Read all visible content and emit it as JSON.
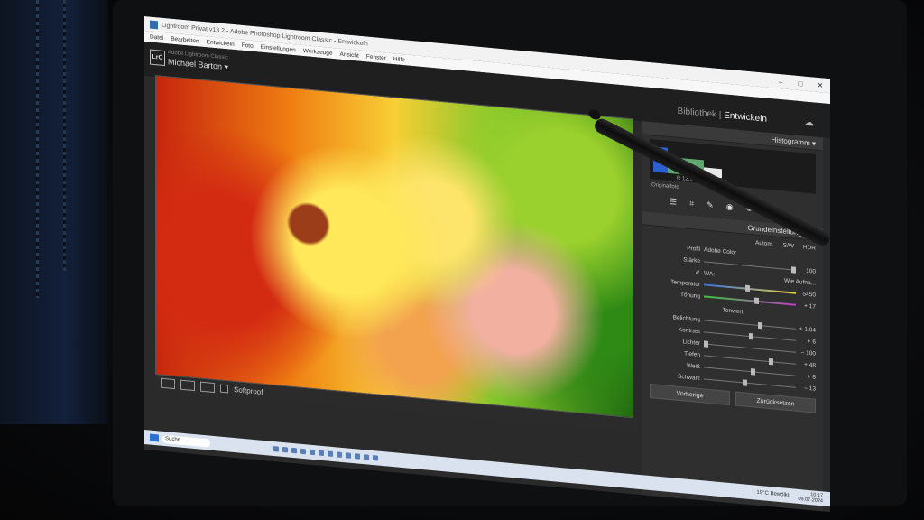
{
  "window": {
    "title": "Lightroom Privat v13.2 - Adobe Photoshop Lightroom Classic - Entwickeln",
    "controls": [
      "–",
      "□",
      "✕"
    ]
  },
  "menu": [
    "Datei",
    "Bearbeiten",
    "Entwickeln",
    "Foto",
    "Einstellungen",
    "Werkzeuge",
    "Ansicht",
    "Fenster",
    "Hilfe"
  ],
  "identity": {
    "badge": "LrC",
    "product": "Adobe Lightroom Classic",
    "user": "Michael Barton ▾"
  },
  "modules": {
    "library": "Bibliothek",
    "develop": "Entwickeln"
  },
  "toolbar": {
    "softproof": "Softproof"
  },
  "panel": {
    "histogram_title": "Histogramm ▾",
    "histo_values": "R 12,5  G 15,9  B 11,6",
    "original_label": "Originalfoto",
    "basic_title": "Grundeinstellungen ▾",
    "tabs": {
      "auto": "Autom.",
      "bw": "S/W",
      "hdr": "HDR"
    },
    "profile_label": "Profil",
    "profile_value": "Adobe Color",
    "strength_label": "Stärke",
    "strength_value": "100",
    "wb_label": "WA:",
    "wb_value": "Wie Aufna...",
    "temp_label": "Temperatur",
    "temp_value": "5450",
    "tint_label": "Tönung",
    "tint_value": "+ 17",
    "tone_label": "Tonwert",
    "sliders": [
      {
        "label": "Belichtung",
        "value": "+ 1,04",
        "pos": 0.62
      },
      {
        "label": "Kontrast",
        "value": "+ 6",
        "pos": 0.52
      },
      {
        "label": "Lichter",
        "value": "– 100",
        "pos": 0.0
      },
      {
        "label": "Tiefen",
        "value": "+ 48",
        "pos": 0.74
      },
      {
        "label": "Weiß",
        "value": "+ 8",
        "pos": 0.54
      },
      {
        "label": "Schwarz",
        "value": "– 13",
        "pos": 0.44
      }
    ],
    "prev_button": "Vorherige",
    "reset_button": "Zurücksetzen"
  },
  "taskbar": {
    "search": "Suche",
    "weather": "19°C Bewölkt",
    "time": "10:17",
    "date": "09.07.2024"
  }
}
